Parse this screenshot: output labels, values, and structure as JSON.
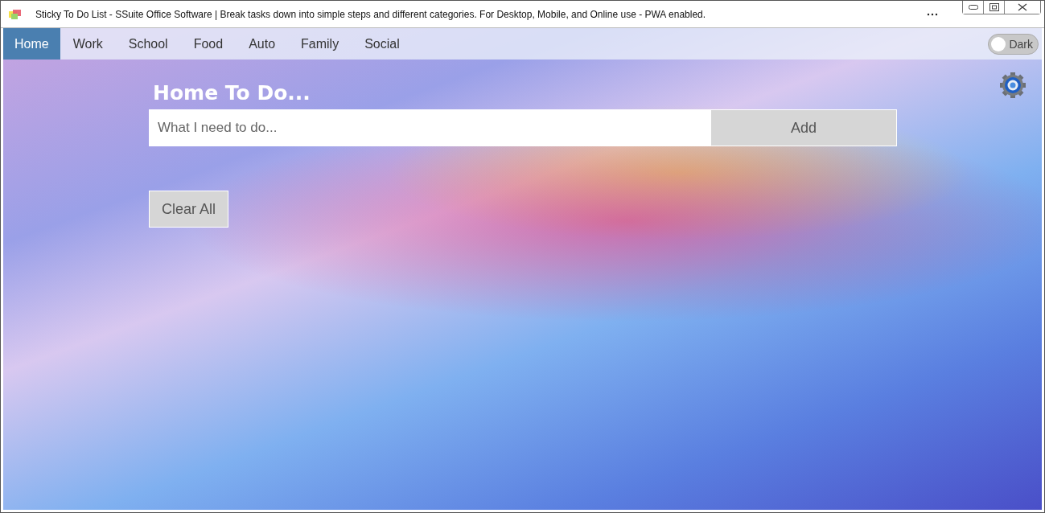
{
  "window": {
    "title": "Sticky To Do List - SSuite Office Software | Break tasks down into simple steps and different categories. For Desktop, Mobile, and Online use - PWA enabled."
  },
  "tabs": [
    {
      "label": "Home",
      "selected": true
    },
    {
      "label": "Work",
      "selected": false
    },
    {
      "label": "School",
      "selected": false
    },
    {
      "label": "Food",
      "selected": false
    },
    {
      "label": "Auto",
      "selected": false
    },
    {
      "label": "Family",
      "selected": false
    },
    {
      "label": "Social",
      "selected": false
    }
  ],
  "dark_toggle": {
    "label": "Dark",
    "on": false
  },
  "heading": "Home To Do...",
  "task_input": {
    "placeholder": "What I need to do..."
  },
  "add_button": "Add",
  "clear_button": "Clear All"
}
